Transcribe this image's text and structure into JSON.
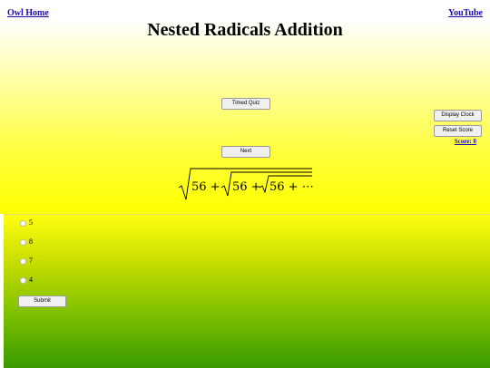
{
  "header": {
    "home_link": "Owl Home",
    "youtube_link": "YouTube",
    "title": "Nested Radicals Addition"
  },
  "buttons": {
    "timed_quiz": "Timed Quiz",
    "next": "Next",
    "display_clock": "Display Clock",
    "reset_score": "Reset Score",
    "submit": "Submit"
  },
  "score": {
    "label": "Score:",
    "value": "0"
  },
  "problem": {
    "outer_term": "56 +",
    "middle_term": "56 +",
    "inner_term": "56 + ⋯"
  },
  "options": [
    "5",
    "8",
    "7",
    "4"
  ],
  "colors": {
    "link": "#1a0dab",
    "top_background": "#ffff00",
    "bottom_background_end": "#3a9a00"
  }
}
